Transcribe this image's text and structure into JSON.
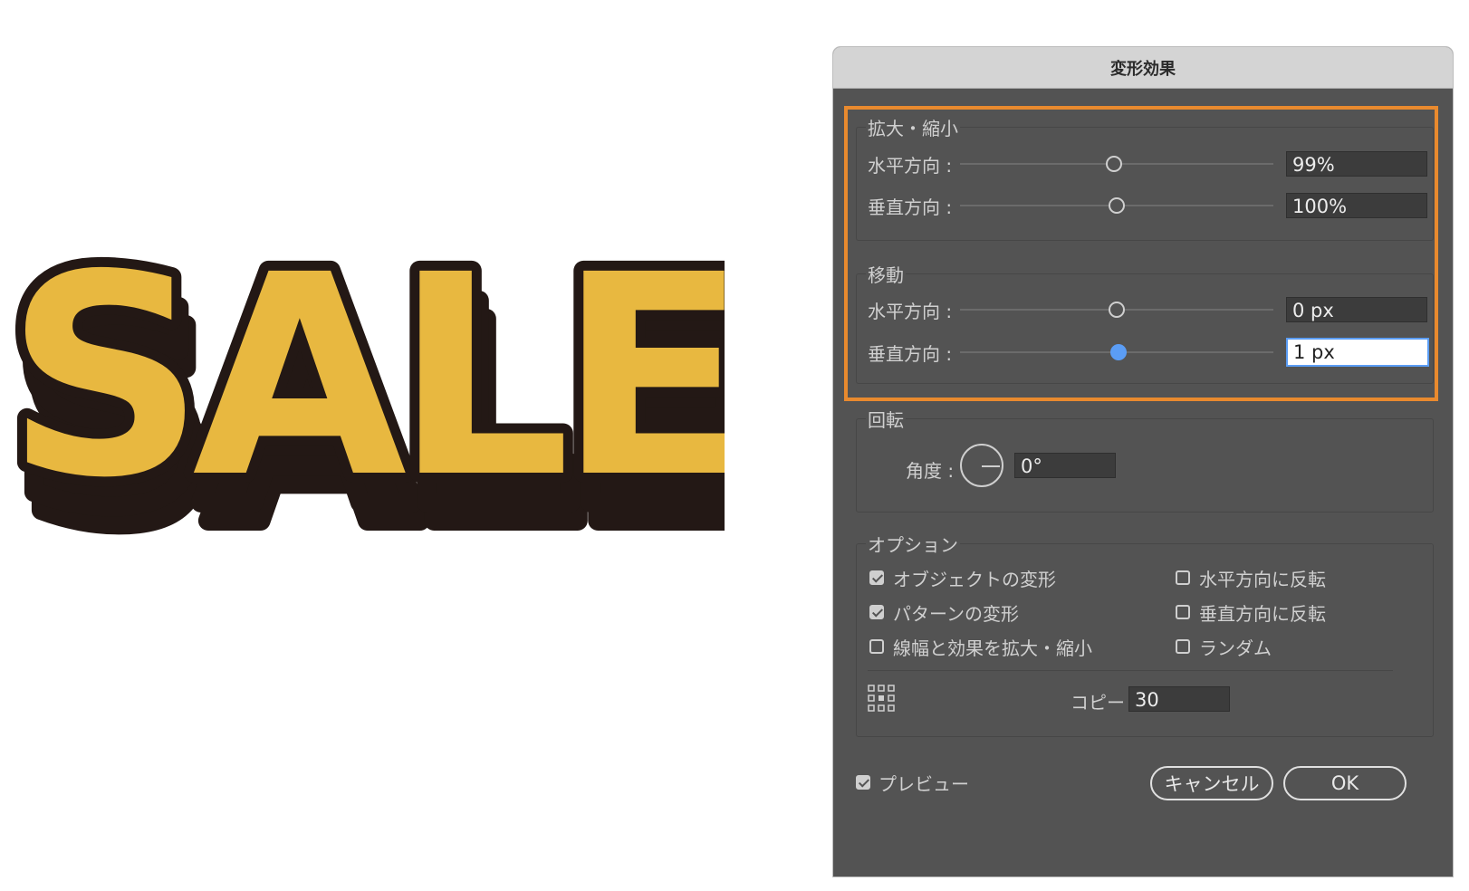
{
  "artwork": {
    "text": "SALE",
    "fill_color": "#e8b840",
    "outline_color": "#231815"
  },
  "dialog": {
    "title": "変形効果",
    "scale": {
      "legend": "拡大・縮小",
      "horizontal_label": "水平方向 :",
      "horizontal_value": "99%",
      "horizontal_slider": 0.49,
      "vertical_label": "垂直方向 :",
      "vertical_value": "100%",
      "vertical_slider": 0.5
    },
    "move": {
      "legend": "移動",
      "horizontal_label": "水平方向 :",
      "horizontal_value": "0 px",
      "horizontal_slider": 0.5,
      "vertical_label": "垂直方向 :",
      "vertical_value": "1 px",
      "vertical_slider": 0.505
    },
    "rotate": {
      "legend": "回転",
      "angle_label": "角度 :",
      "angle_value": "0°"
    },
    "options": {
      "legend": "オプション",
      "items": [
        {
          "label": "オブジェクトの変形",
          "checked": true
        },
        {
          "label": "パターンの変形",
          "checked": true
        },
        {
          "label": "線幅と効果を拡大・縮小",
          "checked": false
        },
        {
          "label": "水平方向に反転",
          "checked": false
        },
        {
          "label": "垂直方向に反転",
          "checked": false
        },
        {
          "label": "ランダム",
          "checked": false
        }
      ],
      "copy_label": "コピー",
      "copy_value": "30"
    },
    "preview_label": "プレビュー",
    "preview_checked": true,
    "cancel_label": "キャンセル",
    "ok_label": "OK"
  },
  "colors": {
    "highlight": "#e98a2e",
    "dialog_bg": "#535353",
    "accent": "#5b9df5"
  }
}
